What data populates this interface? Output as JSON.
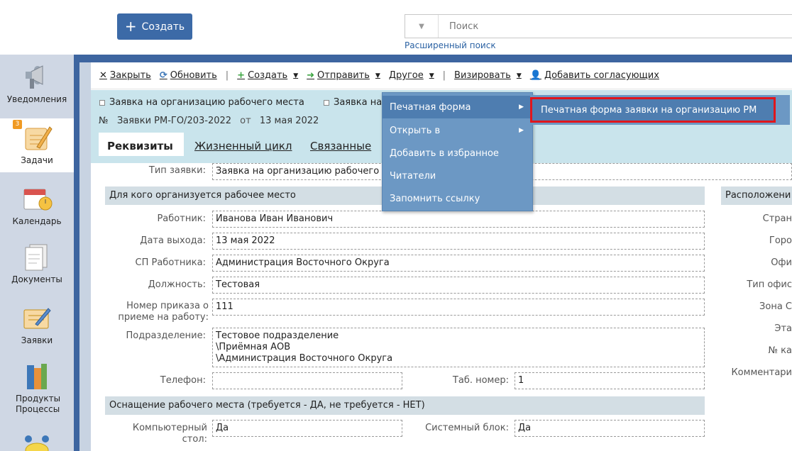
{
  "header": {
    "create_label": "Создать",
    "search_placeholder": "Поиск",
    "advanced_search": "Расширенный поиск"
  },
  "sidebar": {
    "items": [
      {
        "label": "Уведомления",
        "icon": "megaphone-icon"
      },
      {
        "label": "Задачи",
        "icon": "tasks-icon",
        "badge": "3"
      },
      {
        "label": "Календарь",
        "icon": "calendar-icon"
      },
      {
        "label": "Документы",
        "icon": "documents-icon"
      },
      {
        "label": "Заявки",
        "icon": "requests-icon"
      },
      {
        "label": "Продукты Процессы",
        "icon": "books-icon"
      }
    ]
  },
  "toolbar": {
    "close": "Закрыть",
    "refresh": "Обновить",
    "create": "Создать",
    "send": "Отправить",
    "other": "Другое",
    "approve": "Визировать",
    "add_approvers": "Добавить согласующих"
  },
  "doc": {
    "crumb1": "Заявка на организацию рабочего места",
    "crumb2": "Заявка на",
    "num_prefix": "№",
    "num": "Заявки РМ-ГО/203-2022",
    "from": "от",
    "date": "13 мая 2022"
  },
  "tabs": [
    "Реквизиты",
    "Жизненный цикл",
    "Связанные"
  ],
  "form": {
    "type_label": "Тип заявки:",
    "type_value": "Заявка на организацию рабочего",
    "section1": "Для кого организуется рабочее место",
    "section_right": "Расположени",
    "employee_label": "Работник:",
    "employee_value": "Иванова Иван Иванович",
    "exit_date_label": "Дата выхода:",
    "exit_date_value": "13 мая 2022",
    "sp_label": "СП Работника:",
    "sp_value": "Администрация Восточного Округа",
    "position_label": "Должность:",
    "position_value": "Тестовая",
    "order_label": "Номер приказа о приеме на работу:",
    "order_value": "111",
    "division_label": "Подразделение:",
    "division_lines": [
      "Тестовое подразделение",
      "\\Приёмная АОВ",
      "\\Администрация Восточного Округа"
    ],
    "phone_label": "Телефон:",
    "phone_value": "",
    "tab_label": "Таб. номер:",
    "tab_value": "1",
    "section2": "Оснащение рабочего места (требуется - ДА, не требуется - НЕТ)",
    "desk_label": "Компьютерный стол:",
    "desk_value": "Да",
    "unit_label": "Системный блок:",
    "unit_value": "Да",
    "right_labels": [
      "Стран",
      "Горо",
      "Офи",
      "Тип офис",
      "Зона С",
      "Эта",
      "№ ка",
      "Комментари"
    ]
  },
  "menu": {
    "items": [
      "Печатная форма",
      "Открыть в",
      "Добавить в избранное",
      "Читатели",
      "Запомнить ссылку"
    ],
    "submenu": "Печатная форма заявки на организацию РМ"
  },
  "colors": {
    "brand": "#3c6aa7",
    "menu_bg": "#6c98c4",
    "menu_highlight": "#4e7db0",
    "highlight_border": "#e0161c",
    "header_bg": "#c9e4ec",
    "section_bg": "#d3dee4"
  }
}
